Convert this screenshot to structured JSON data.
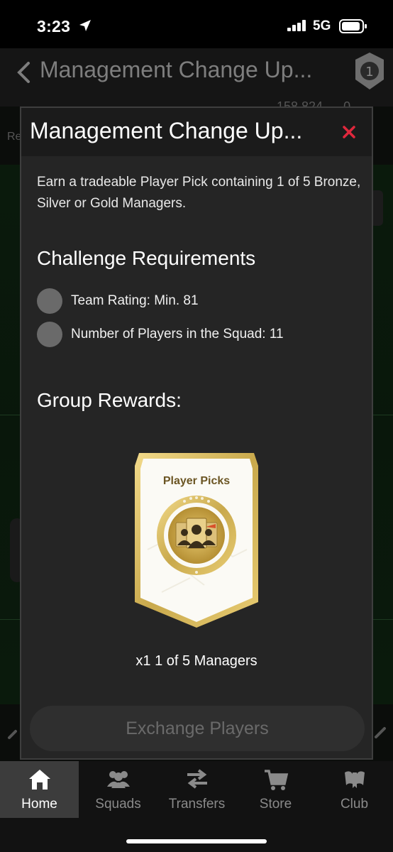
{
  "status_bar": {
    "time": "3:23",
    "network": "5G",
    "icons": [
      "location-arrow-icon",
      "signal-icon",
      "battery-icon"
    ]
  },
  "page": {
    "title": "Management Change Up...",
    "coins": "158,824",
    "points": "0",
    "partial_label": "Re",
    "icons": [
      "back-chevron-icon",
      "objective-badge-icon"
    ]
  },
  "modal": {
    "title": "Management Change Up...",
    "close_icon": "close-x-icon",
    "description": "Earn a tradeable Player Pick containing 1 of 5 Bronze, Silver or Gold Managers.",
    "requirements_heading": "Challenge Requirements",
    "requirements": [
      {
        "text": "Team Rating: Min. 81",
        "met": false
      },
      {
        "text": "Number of Players in the Squad: 11",
        "met": false
      }
    ],
    "rewards_heading": "Group Rewards:",
    "reward": {
      "card_title": "Player Picks",
      "label": "x1 1 of 5 Managers",
      "icon": "player-pick-card-icon"
    },
    "exchange_button": "Exchange Players"
  },
  "nav": [
    {
      "label": "Home",
      "icon": "home-icon",
      "active": true
    },
    {
      "label": "Squads",
      "icon": "squads-icon",
      "active": false
    },
    {
      "label": "Transfers",
      "icon": "transfers-icon",
      "active": false
    },
    {
      "label": "Store",
      "icon": "cart-icon",
      "active": false
    },
    {
      "label": "Club",
      "icon": "club-icon",
      "active": false
    }
  ],
  "colors": {
    "modal_bg": "#252525",
    "header_bg": "#1b1b1b",
    "close_red": "#e0283c",
    "card_gold": "#c9a94c",
    "dot_gray": "#6a6a6a"
  }
}
